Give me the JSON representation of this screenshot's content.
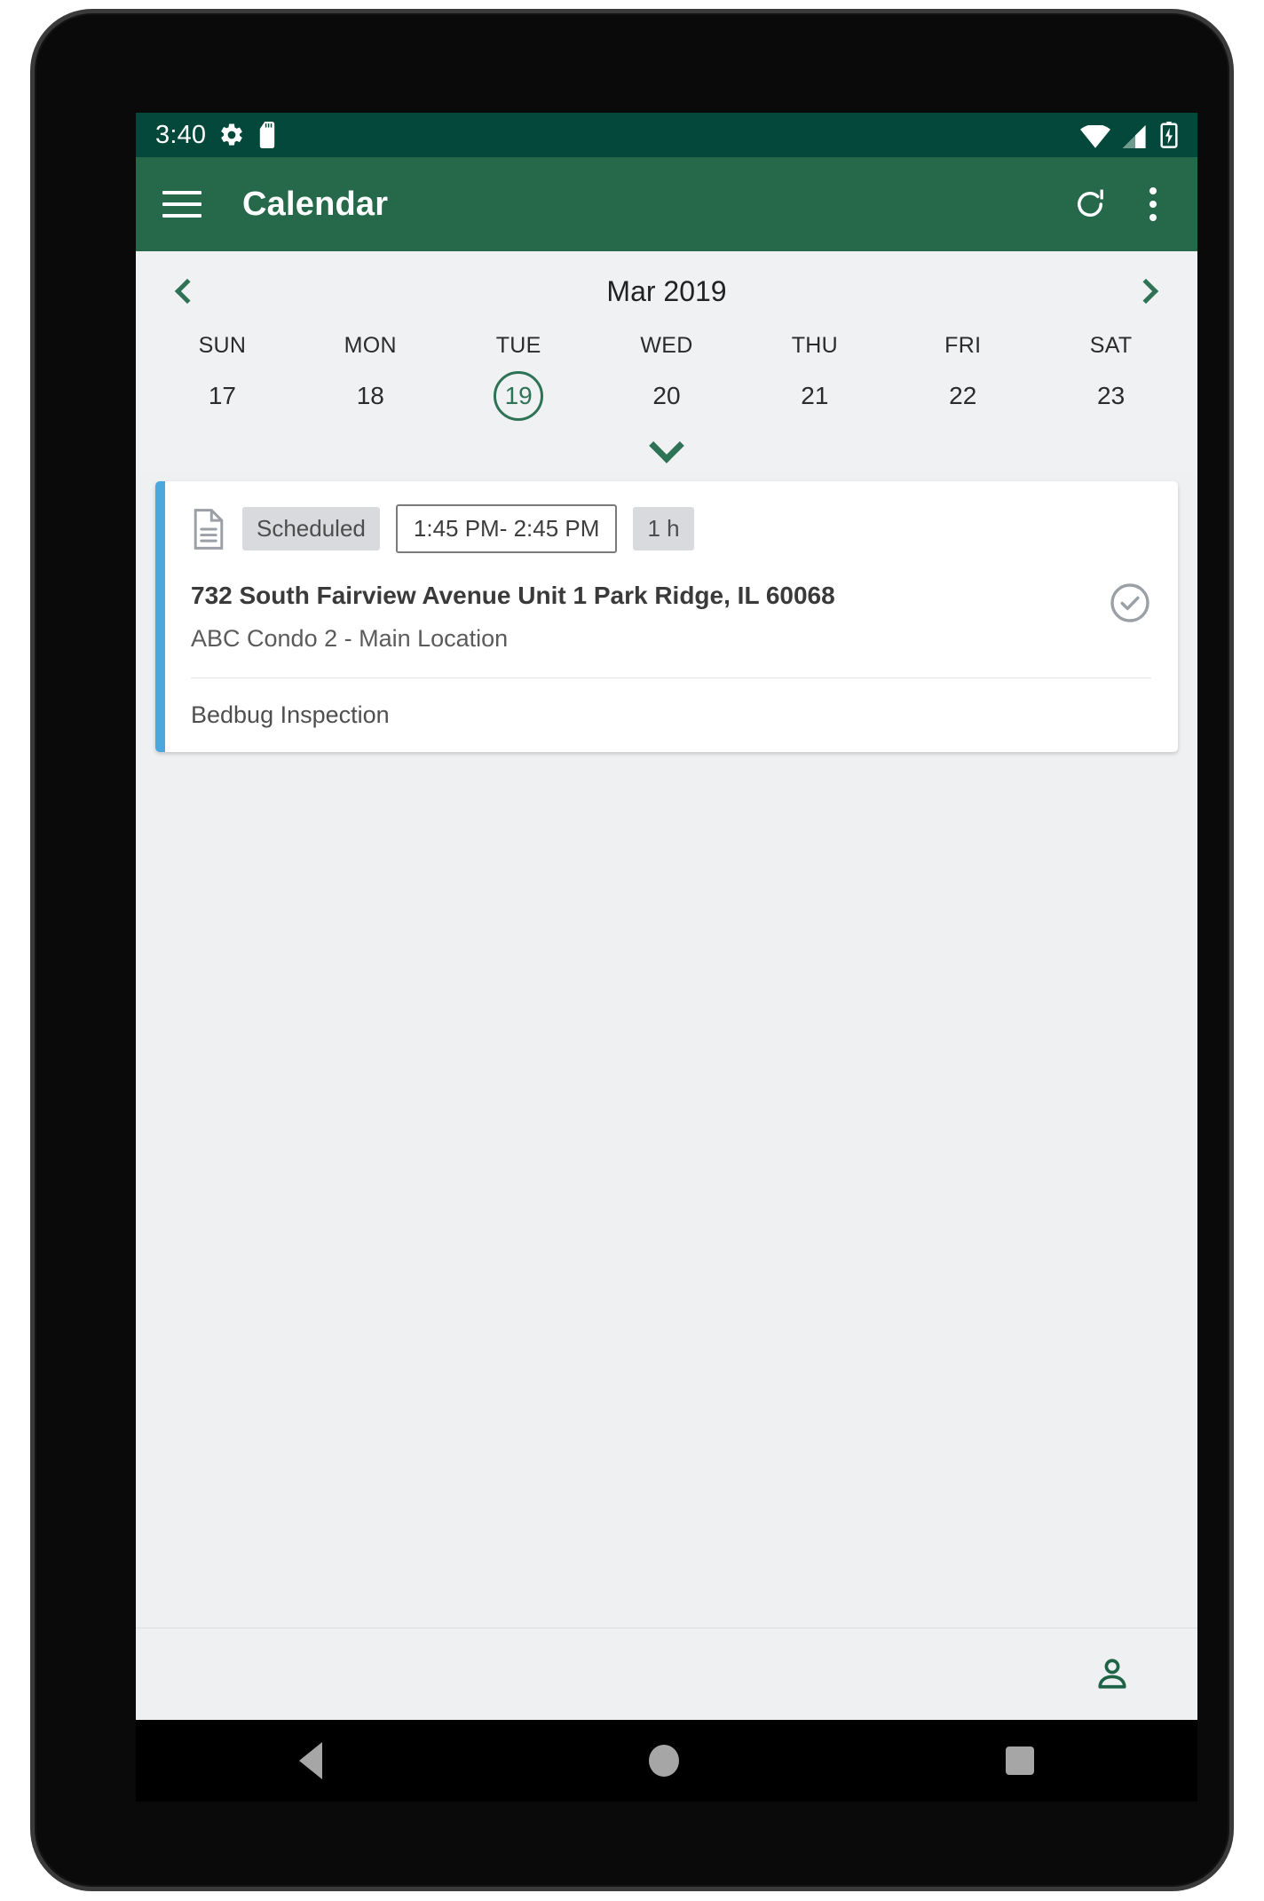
{
  "status_bar": {
    "time": "3:40",
    "icons": [
      "gear-icon",
      "sd-card-icon",
      "wifi-icon",
      "cell-signal-icon",
      "battery-charging-icon"
    ],
    "background": "#03483a"
  },
  "app_bar": {
    "menu_icon": "hamburger-menu-icon",
    "title": "Calendar",
    "refresh_icon": "refresh-icon",
    "overflow_icon": "more-vertical-icon",
    "background": "#25684a"
  },
  "week_strip": {
    "prev_icon": "chevron-left-icon",
    "month_label": "Mar 2019",
    "next_icon": "chevron-right-icon",
    "expand_icon": "chevron-down-icon",
    "selected_index": 2,
    "accent": "#2e7355",
    "days": [
      {
        "name": "SUN",
        "num": "17"
      },
      {
        "name": "MON",
        "num": "18"
      },
      {
        "name": "TUE",
        "num": "19"
      },
      {
        "name": "WED",
        "num": "20"
      },
      {
        "name": "THU",
        "num": "21"
      },
      {
        "name": "FRI",
        "num": "22"
      },
      {
        "name": "SAT",
        "num": "23"
      }
    ]
  },
  "event_card": {
    "accent_color": "#4aa8de",
    "doc_icon": "document-icon",
    "status_chip": "Scheduled",
    "time_range": "1:45 PM- 2:45 PM",
    "duration_chip": "1 h",
    "address": "732 South Fairview Avenue Unit 1 Park Ridge, IL 60068",
    "location": "ABC Condo 2 - Main Location",
    "complete_icon": "check-circle-icon",
    "service": "Bedbug Inspection"
  },
  "bottom_bar": {
    "account_icon": "person-icon",
    "accent": "#1f6347"
  },
  "nav_bar": {
    "back_icon": "back-triangle-icon",
    "home_icon": "home-circle-icon",
    "recents_icon": "recents-square-icon"
  }
}
